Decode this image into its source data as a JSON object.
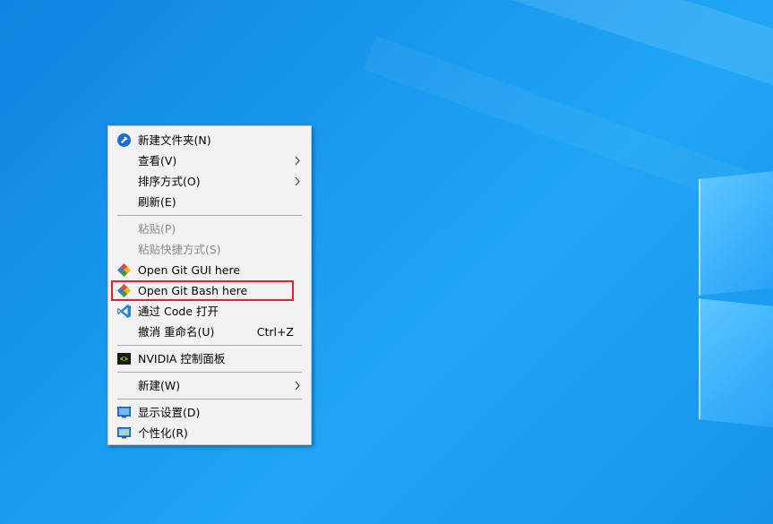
{
  "context_menu": {
    "items": [
      {
        "label": "新建文件夹(N)",
        "icon": "new-folder-icon"
      },
      {
        "label": "查看(V)",
        "submenu": true
      },
      {
        "label": "排序方式(O)",
        "submenu": true
      },
      {
        "label": "刷新(E)"
      },
      {
        "label": "粘贴(P)",
        "disabled": true
      },
      {
        "label": "粘贴快捷方式(S)",
        "disabled": true
      },
      {
        "label": "Open Git GUI here",
        "icon": "git-icon"
      },
      {
        "label": "Open Git Bash here",
        "icon": "git-icon",
        "highlighted": true
      },
      {
        "label": "通过 Code 打开",
        "icon": "vscode-icon"
      },
      {
        "label": "撤消 重命名(U)",
        "shortcut": "Ctrl+Z"
      },
      {
        "label": "NVIDIA 控制面板",
        "icon": "nvidia-icon"
      },
      {
        "label": "新建(W)",
        "submenu": true
      },
      {
        "label": "显示设置(D)",
        "icon": "display-settings-icon"
      },
      {
        "label": "个性化(R)",
        "icon": "personalize-icon"
      }
    ]
  },
  "colors": {
    "highlight_border": "#e0242b",
    "menu_background": "#f2f2f2",
    "desktop_blue": "#1a9bf0"
  }
}
